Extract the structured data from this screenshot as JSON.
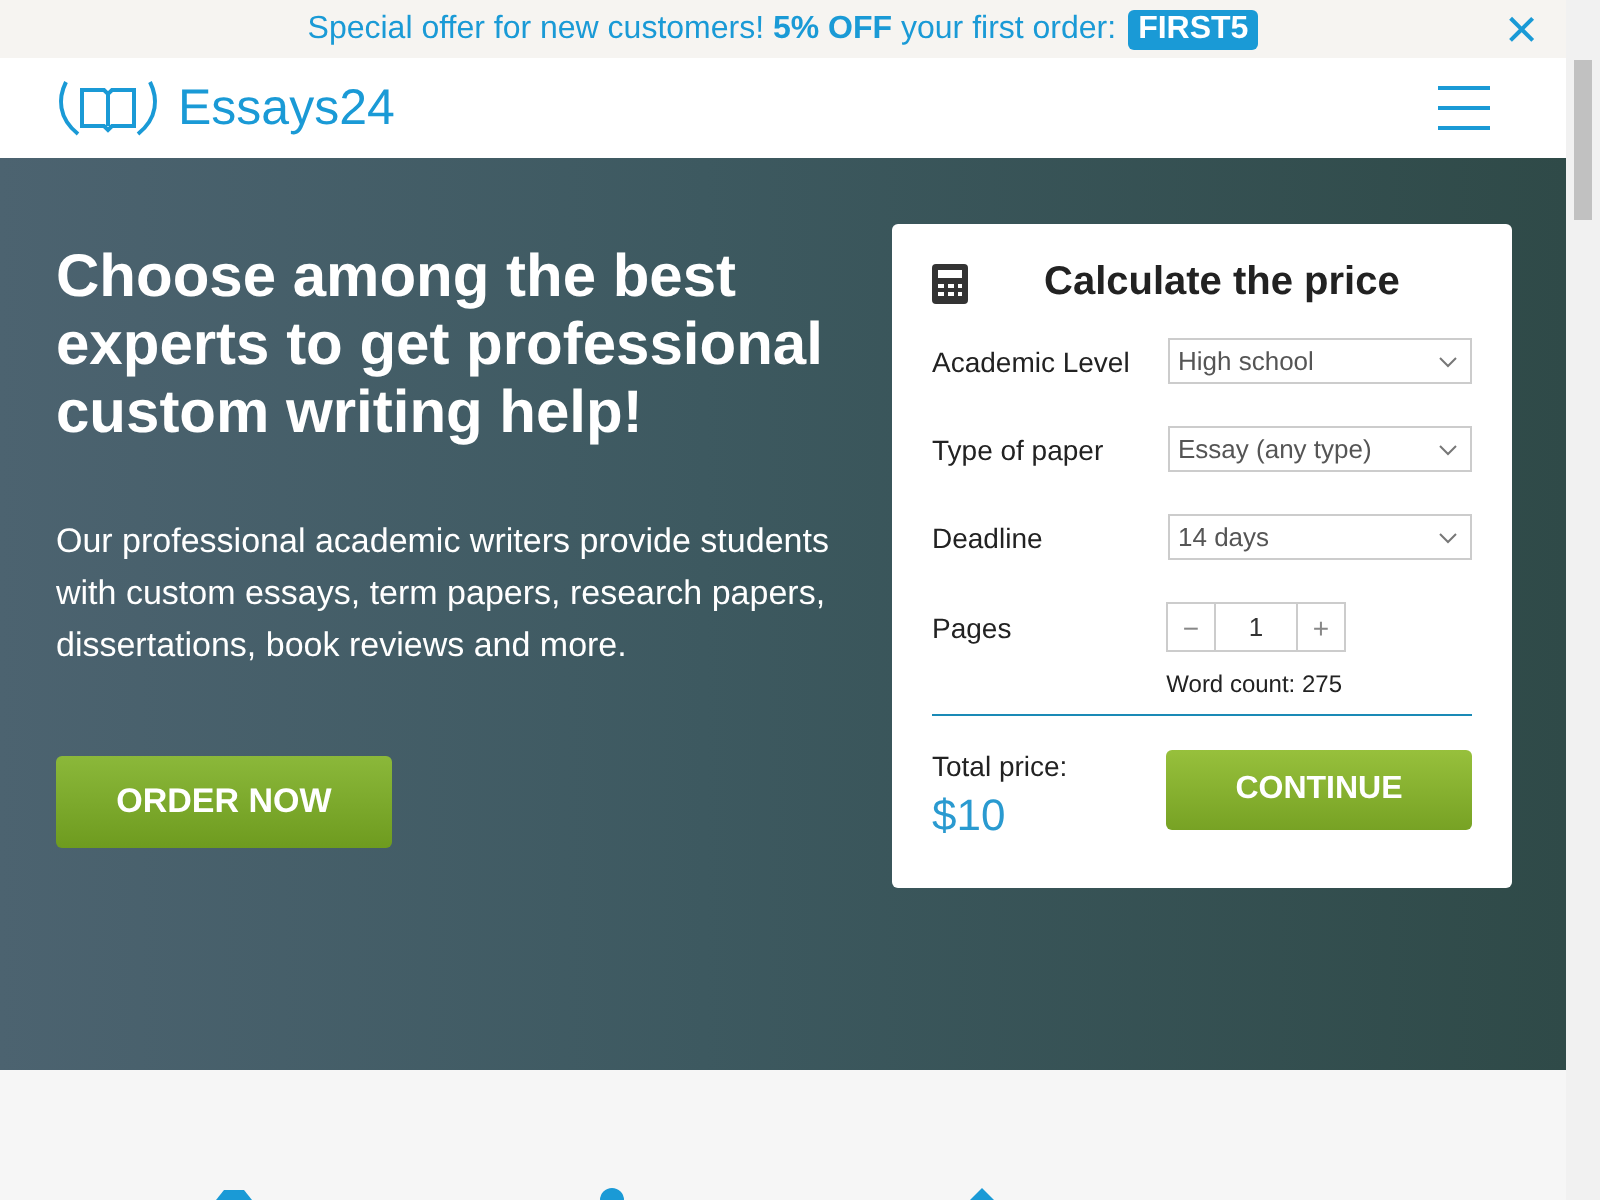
{
  "promo_bar": {
    "text": "Special offer for new customers! **5% OFF** your first order:",
    "code": "FIRST5",
    "close": "×"
  },
  "header": {
    "logo": "Essays24"
  },
  "hero": {
    "heading": "Choose among the best experts to get professional custom writing help!",
    "text": "Our professional academic writers provide students with custom essays, term papers, research papers, dissertations, book reviews and more.",
    "button": "ORDER NOW"
  },
  "calculator": {
    "title": "Calculate the price",
    "fields": [
      {
        "label": "Academic Level",
        "value": "High school"
      },
      {
        "label": "Type of paper",
        "value": "Essay (any type)"
      },
      {
        "label": "Deadline",
        "value": "14 days"
      }
    ],
    "pages": {
      "label": "Pages",
      "minus": "−",
      "value": "1",
      "plus": "+",
      "word_count": "Word count: 275"
    },
    "total_label": "Total price:",
    "total": "$10",
    "button": "CONTINUE"
  }
}
